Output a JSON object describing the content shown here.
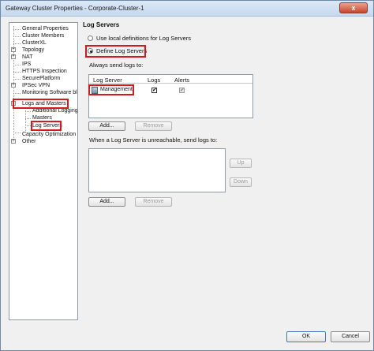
{
  "window": {
    "title": "Gateway Cluster Properties - Corporate-Cluster-1",
    "close_label": "x"
  },
  "tree": {
    "items": [
      {
        "label": "General Properties"
      },
      {
        "label": "Cluster Members"
      },
      {
        "label": "ClusterXL"
      },
      {
        "label": "Topology"
      },
      {
        "label": "NAT"
      },
      {
        "label": "IPS"
      },
      {
        "label": "HTTPS Inspection"
      },
      {
        "label": "SecurePlatform"
      },
      {
        "label": "IPSec VPN"
      },
      {
        "label": "Monitoring Software bla"
      },
      {
        "label": "Logs and Masters"
      },
      {
        "label": "Additional Logging"
      },
      {
        "label": "Masters"
      },
      {
        "label": "Log Servers"
      },
      {
        "label": "Capacity Optimization"
      },
      {
        "label": "Other"
      }
    ],
    "expander_plus": "+",
    "expander_minus": "-"
  },
  "main": {
    "section_title": "Log Servers",
    "radio_local": "Use local definitions for Log Servers",
    "radio_define": "Define Log Servers",
    "always_send_label": "Always send logs to:",
    "log_table": {
      "headers": [
        "Log Server",
        "Logs",
        "Alerts"
      ],
      "rows": [
        {
          "server": "Management",
          "logs": "✔",
          "alerts": "✔"
        }
      ]
    },
    "add_button": "Add...",
    "remove_button": "Remove",
    "unreachable_label": "When a Log Server is unreachable, send logs to:",
    "up_button": "Up",
    "down_button": "Down",
    "add_button_2": "Add...",
    "remove_button_2": "Remove"
  },
  "footer": {
    "ok": "OK",
    "cancel": "Cancel"
  },
  "colors": {
    "highlight": "#d3191c",
    "window_border": "#6f8aa8"
  }
}
